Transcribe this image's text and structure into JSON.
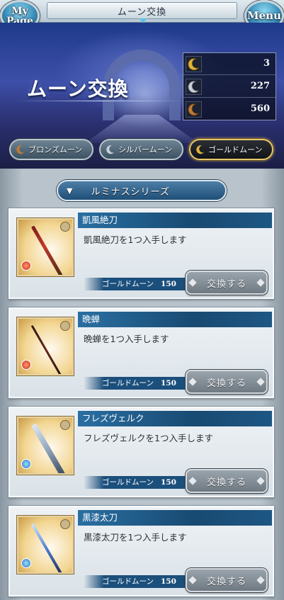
{
  "header": {
    "title": "ムーン交換",
    "mypage_label_1": "My",
    "mypage_label_2": "Page",
    "menu_label": "Menu"
  },
  "hero": {
    "title": "ムーン交換"
  },
  "moon_counts": [
    {
      "type": "gold",
      "icon": "gold-moon-icon",
      "count": "3"
    },
    {
      "type": "silver",
      "icon": "silver-moon-icon",
      "count": "227"
    },
    {
      "type": "bronze",
      "icon": "bronze-moon-icon",
      "count": "560"
    }
  ],
  "tabs": [
    {
      "label": "ブロンズムーン",
      "active": false
    },
    {
      "label": "シルバームーン",
      "active": false
    },
    {
      "label": "ゴールドムーン",
      "active": true
    }
  ],
  "series": {
    "label": "ルミナスシリーズ"
  },
  "items": [
    {
      "name": "凱風絶刀",
      "desc": "凱風絶刀を1つ入手します",
      "cost_label": "ゴールドムーン",
      "cost": "150",
      "button": "交換する"
    },
    {
      "name": "晩蝉",
      "desc": "晩蝉を1つ入手します",
      "cost_label": "ゴールドムーン",
      "cost": "150",
      "button": "交換する"
    },
    {
      "name": "フレズヴェルク",
      "desc": "フレズヴェルクを1つ入手します",
      "cost_label": "ゴールドムーン",
      "cost": "150",
      "button": "交換する"
    },
    {
      "name": "黒漆太刀",
      "desc": "黒漆太刀を1つ入手します",
      "cost_label": "ゴールドムーン",
      "cost": "150",
      "button": "交換する"
    }
  ],
  "colors": {
    "gold_moon": "#e3b43a",
    "silver_moon": "#c9d0d8",
    "bronze_moon": "#c07a38",
    "accent_blue": "#1b4f7c"
  }
}
